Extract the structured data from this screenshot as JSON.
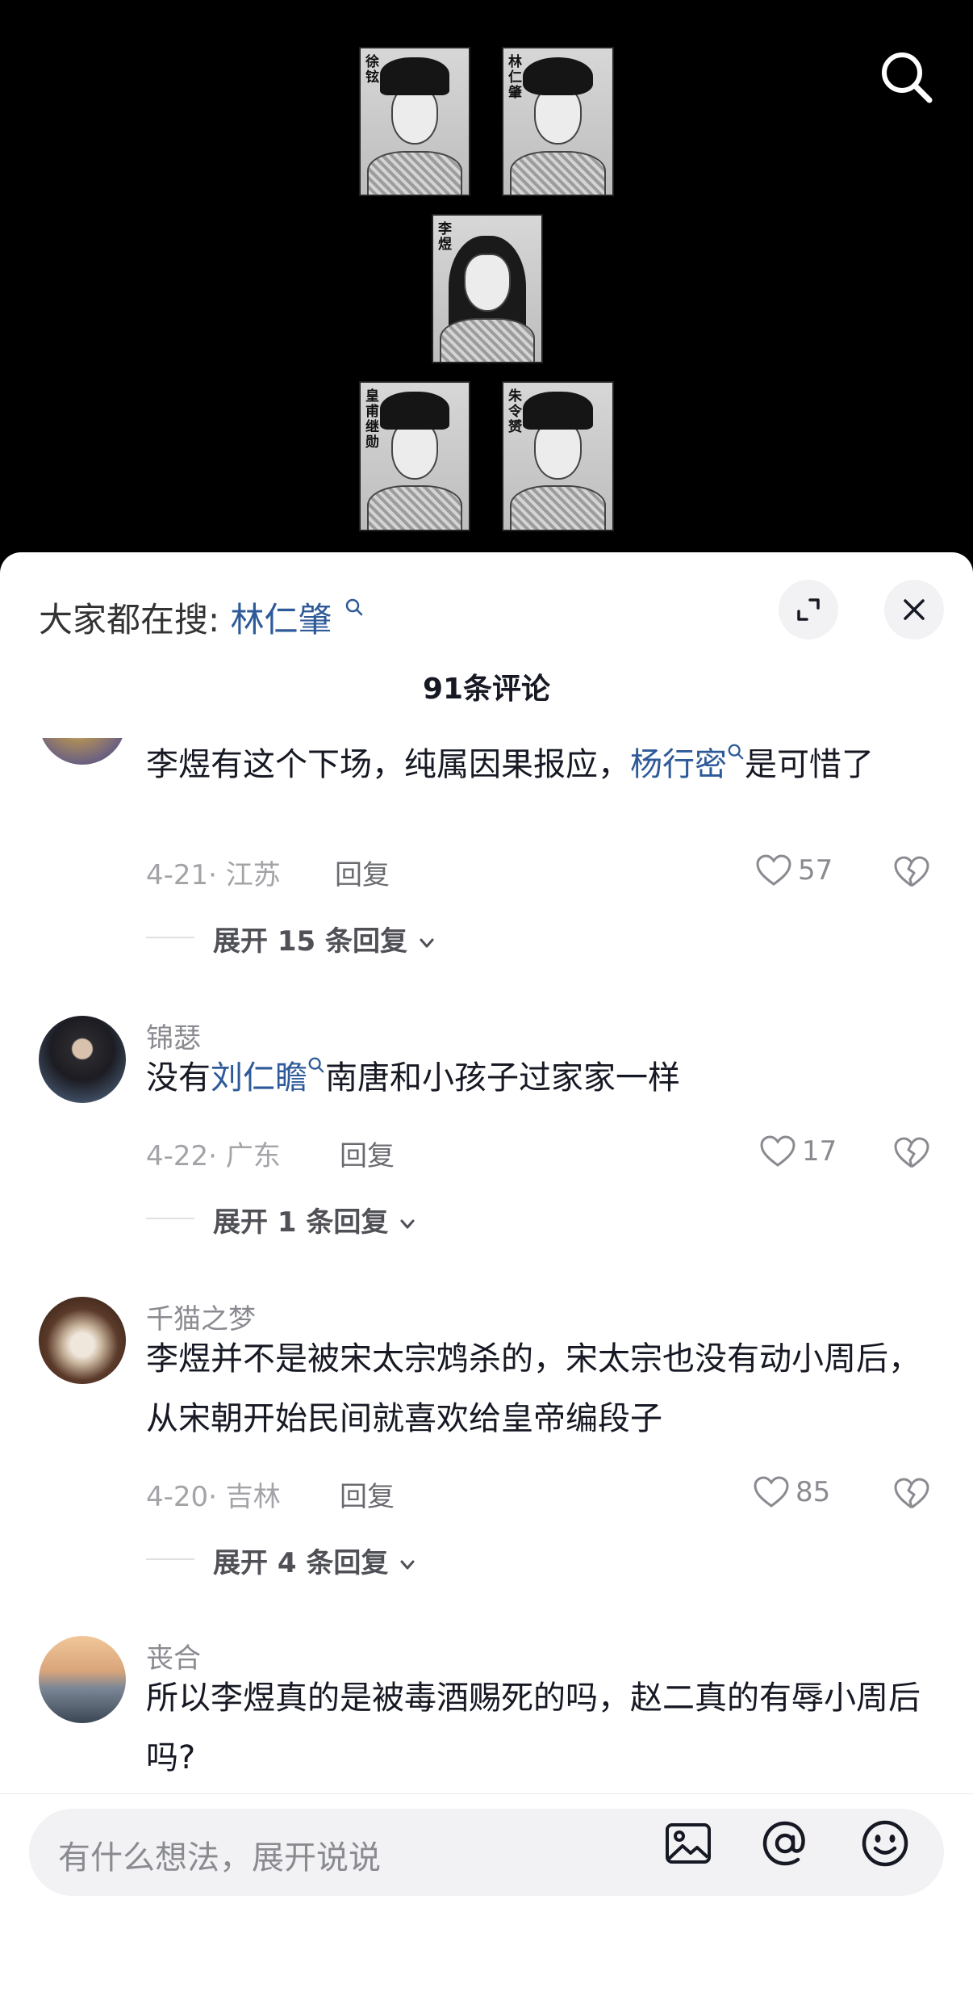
{
  "video": {
    "portraits": [
      {
        "name": "徐铉"
      },
      {
        "name": "林仁肇"
      },
      {
        "name": "李煜"
      },
      {
        "name": "皇甫继勋"
      },
      {
        "name": "朱令赟"
      }
    ]
  },
  "sheet": {
    "hot_search_prefix": "大家都在搜:",
    "hot_search_term": "林仁肇",
    "comment_count": "91条评论"
  },
  "comments": [
    {
      "username": "",
      "text_before": "李煜有这个下场，纯属因果报应，",
      "mention": "杨行密",
      "text_after": "是可惜了",
      "date": "4-21",
      "location": "江苏",
      "reply_label": "回复",
      "likes": "57",
      "expand_label": "展开 15 条回复"
    },
    {
      "username": "锦瑟",
      "text_before": "没有",
      "mention": "刘仁瞻",
      "text_after": "南唐和小孩子过家家一样",
      "date": "4-22",
      "location": "广东",
      "reply_label": "回复",
      "likes": "17",
      "expand_label": "展开 1 条回复"
    },
    {
      "username": "千猫之梦",
      "text_before": "李煜并不是被宋太宗鸩杀的，宋太宗也没有动小周后，从宋朝开始民间就喜欢给皇帝编段子",
      "mention": "",
      "text_after": "",
      "date": "4-20",
      "location": "吉林",
      "reply_label": "回复",
      "likes": "85",
      "expand_label": "展开 4 条回复"
    },
    {
      "username": "丧合",
      "text_before": "所以李煜真的是被毒酒赐死的吗，赵二真的有辱小周后吗?",
      "mention": "",
      "text_after": ""
    }
  ],
  "input": {
    "placeholder": "有什么想法，展开说说"
  },
  "icons": [
    "search-icon",
    "expand-icon",
    "close-icon",
    "heart-icon",
    "broken-heart-icon",
    "chevron-down-icon",
    "image-icon",
    "at-icon",
    "emoji-icon"
  ],
  "colors": {
    "accent_link": "#2e5a99",
    "sheet_bg": "#ffffff",
    "video_bg": "#000000"
  }
}
